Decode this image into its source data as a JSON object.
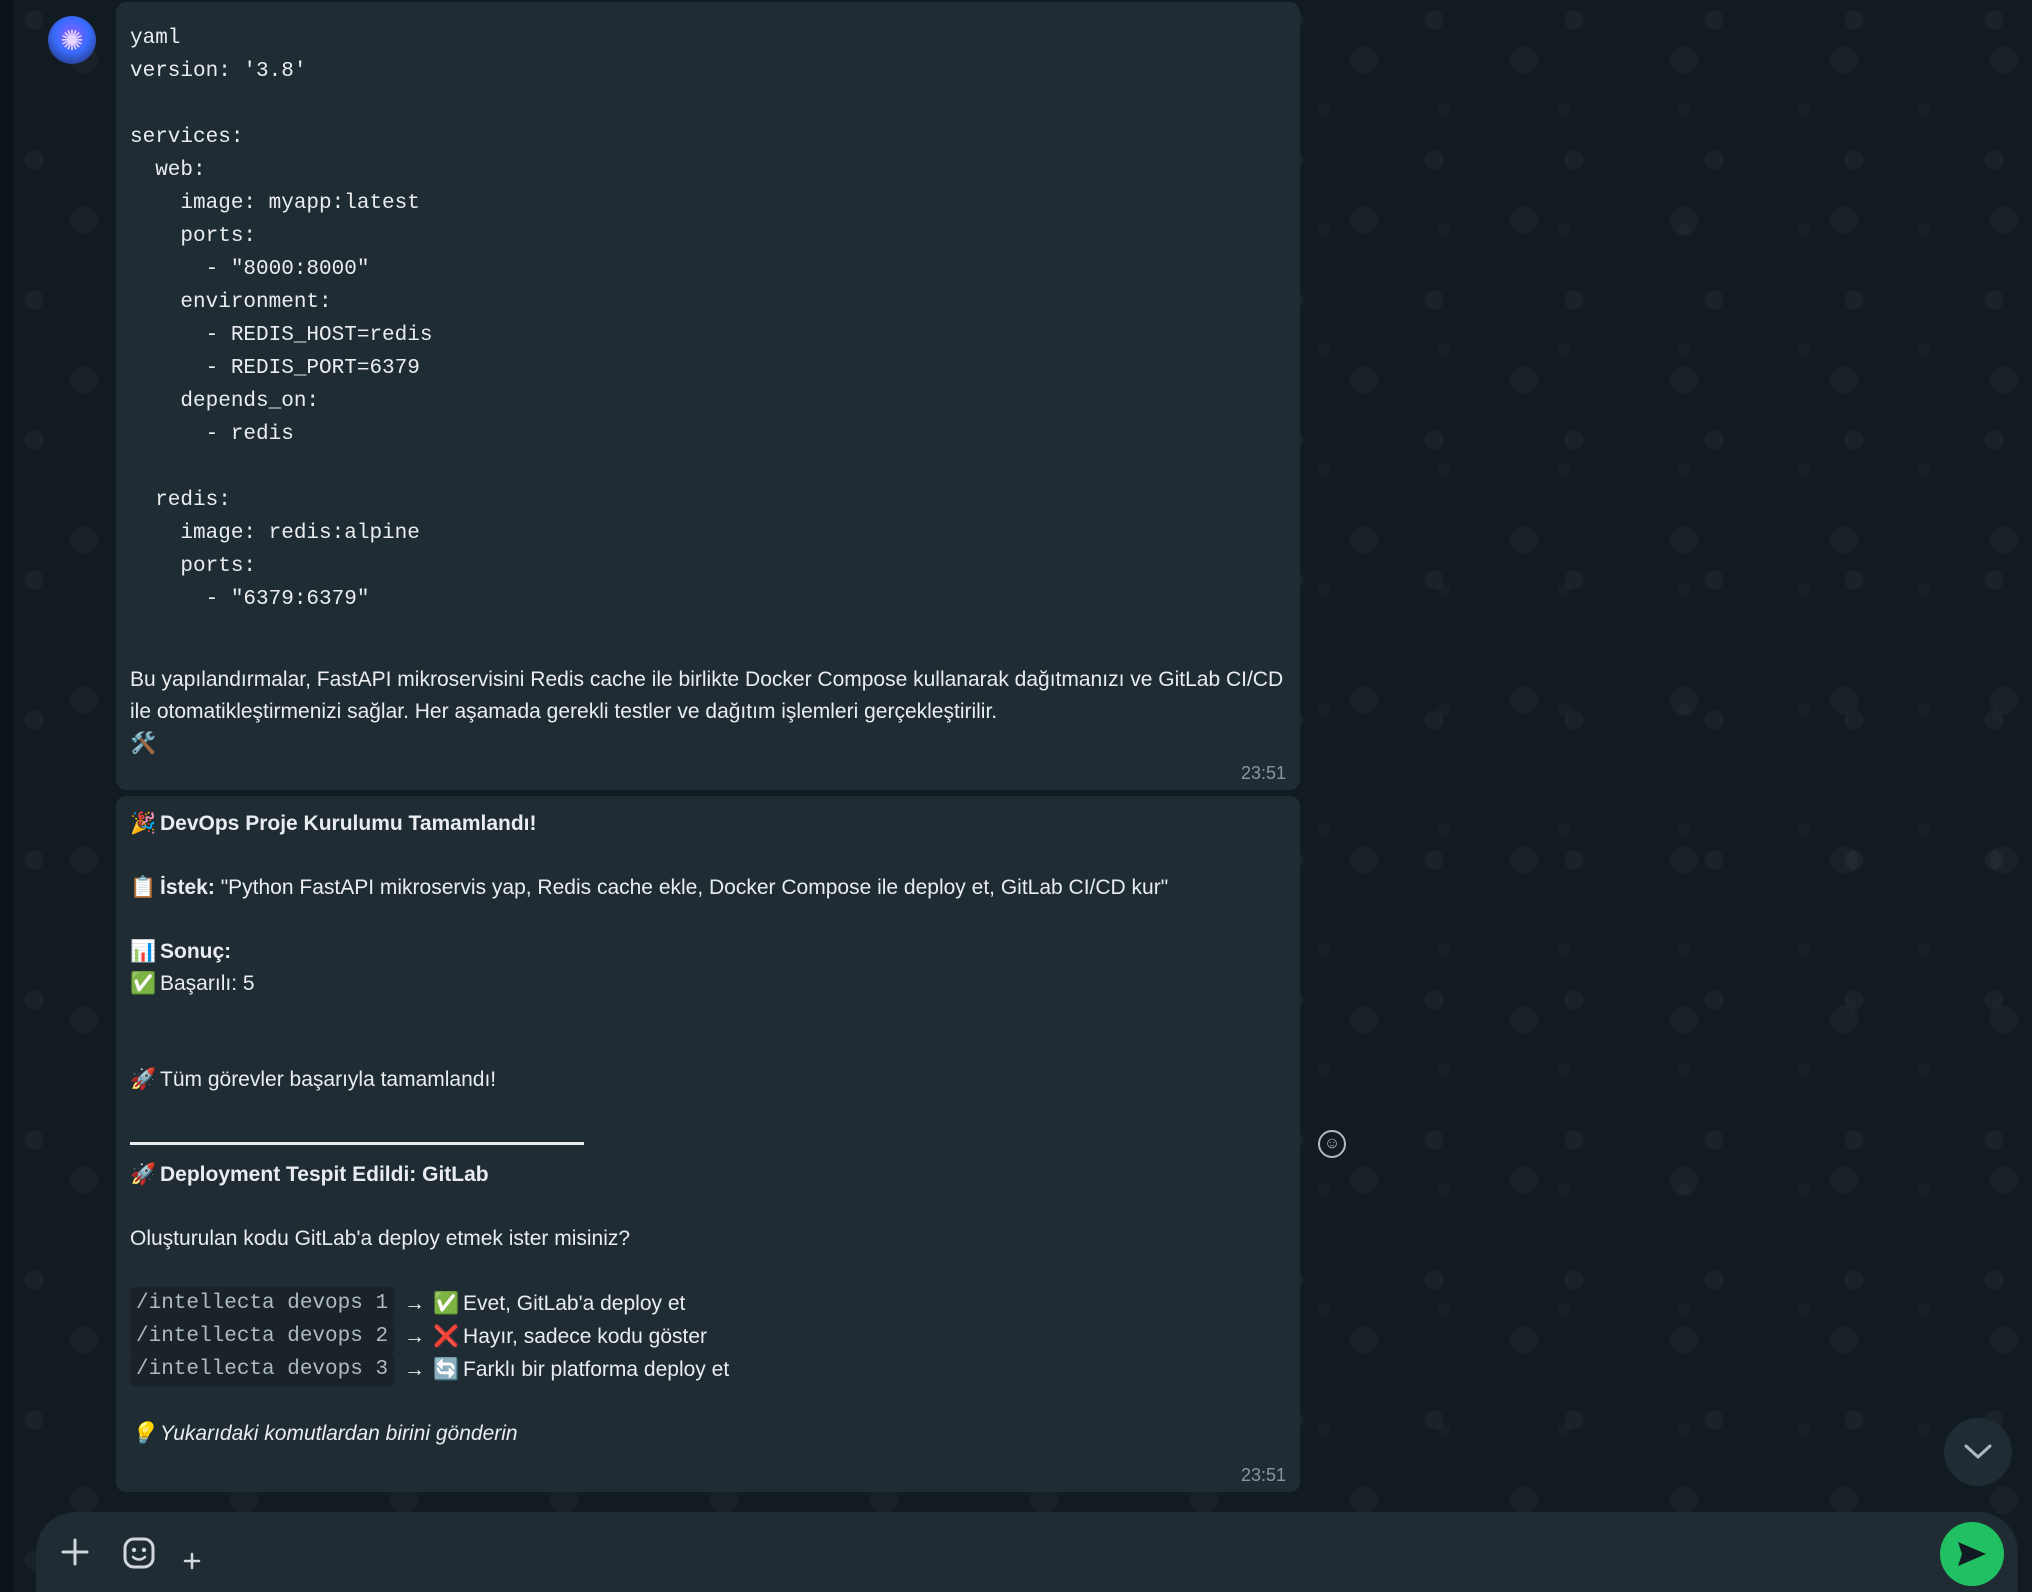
{
  "message1": {
    "code_lines": [
      "yaml",
      "version: '3.8'",
      "",
      "services:",
      "  web:",
      "    image: myapp:latest",
      "    ports:",
      "      - \"8000:8000\"",
      "    environment:",
      "      - REDIS_HOST=redis",
      "      - REDIS_PORT=6379",
      "    depends_on:",
      "      - redis",
      "",
      "  redis:",
      "    image: redis:alpine",
      "    ports:",
      "      - \"6379:6379\""
    ],
    "summary": "Bu yapılandırmalar, FastAPI mikroservisini Redis cache ile birlikte Docker Compose kullanarak dağıtmanızı ve GitLab CI/CD ile otomatikleştirmenizi sağlar. Her aşamada gerekli testler ve dağıtım işlemleri gerçekleştirilir.",
    "trailing_emoji": "🛠️",
    "time": "23:51"
  },
  "message2": {
    "title_emoji": "🎉",
    "title": "DevOps Proje Kurulumu Tamamlandı!",
    "request_emoji": "📋",
    "request_label": "İstek:",
    "request_text": "\"Python FastAPI mikroservis yap, Redis cache ekle, Docker Compose ile deploy et, GitLab CI/CD kur\"",
    "result_emoji": "📊",
    "result_label": "Sonuç:",
    "success_emoji": "✅",
    "success_text": "Başarılı: 5",
    "done_emoji": "🚀",
    "done_text": "Tüm görevler başarıyla tamamlandı!",
    "deploy_emoji": "🚀",
    "deploy_title": "Deployment Tespit Edildi: GitLab",
    "question": "Oluşturulan kodu GitLab'a deploy etmek ister misiniz?",
    "options": [
      {
        "command": "/intellecta devops 1",
        "arrow": "→",
        "emoji": "✅",
        "text": "Evet, GitLab'a deploy et"
      },
      {
        "command": "/intellecta devops 2",
        "arrow": "→",
        "emoji": "❌",
        "text": "Hayır, sadece kodu göster"
      },
      {
        "command": "/intellecta devops 3",
        "arrow": "→",
        "emoji": "🔄",
        "text": "Farklı bir platforma deploy et"
      }
    ],
    "hint_emoji": "💡",
    "hint": "Yukarıdaki komutlardan birini gönderin",
    "time": "23:51"
  },
  "icons": {
    "avatar": "bot-avatar-icon",
    "reaction": "emoji-reaction-icon",
    "scroll": "chevron-down-icon",
    "attach": "plus-icon",
    "sticker": "sticker-icon",
    "extra": "small-plus-icon",
    "send": "send-icon"
  },
  "colors": {
    "send_button": "#21c063",
    "bubble": "#202c33",
    "background": "#111b21"
  }
}
